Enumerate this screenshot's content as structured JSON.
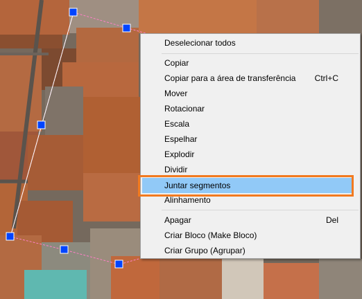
{
  "context_menu": {
    "items": [
      {
        "label": "Deselecionar todos"
      },
      {
        "label": "Copiar"
      },
      {
        "label": "Copiar para a área de transferência",
        "shortcut": "Ctrl+C"
      },
      {
        "label": "Mover"
      },
      {
        "label": "Rotacionar"
      },
      {
        "label": "Escala"
      },
      {
        "label": "Espelhar"
      },
      {
        "label": "Explodir"
      },
      {
        "label": "Dividir"
      },
      {
        "label": "Juntar segmentos",
        "highlighted": true
      },
      {
        "label": "Alinhamento"
      },
      {
        "label": "Apagar",
        "shortcut": "Del"
      },
      {
        "label": "Criar Bloco (Make Bloco)"
      },
      {
        "label": "Criar Grupo (Agrupar)"
      }
    ]
  },
  "colors": {
    "highlight_background": "#91c9f7",
    "highlight_frame": "#f27a1f",
    "selection_handle": "#0044ff",
    "selection_outline": "#ff7fc8"
  }
}
